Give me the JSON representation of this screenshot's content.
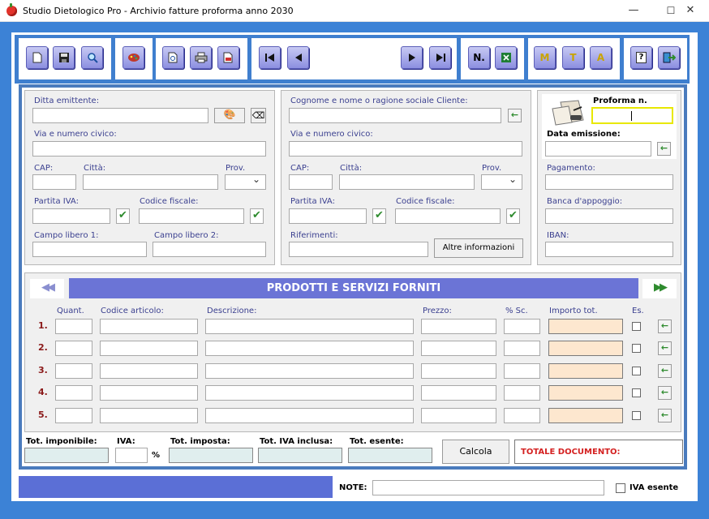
{
  "window": {
    "title": "Studio Dietologico Pro - Archivio fatture proforma anno 2030",
    "minimize": "—",
    "maximize": "☐",
    "close": "✕"
  },
  "toolbar": {
    "n_label": "N.",
    "m_label": "M",
    "t_label": "T",
    "a_label": "A",
    "help_label": "?"
  },
  "emitter": {
    "company_label": "Ditta emittente:",
    "address_label": "Via e numero civico:",
    "cap_label": "CAP:",
    "city_label": "Città:",
    "prov_label": "Prov.",
    "vat_label": "Partita IVA:",
    "tax_code_label": "Codice fiscale:",
    "free1_label": "Campo libero 1:",
    "free2_label": "Campo libero 2:"
  },
  "client": {
    "name_label": "Cognome e nome o ragione sociale Cliente:",
    "address_label": "Via e numero civico:",
    "cap_label": "CAP:",
    "city_label": "Città:",
    "prov_label": "Prov.",
    "vat_label": "Partita IVA:",
    "tax_code_label": "Codice fiscale:",
    "references_label": "Riferimenti:",
    "more_info_button": "Altre informazioni"
  },
  "proforma": {
    "number_label": "Proforma n.",
    "date_label": "Data emissione:",
    "payment_label": "Pagamento:",
    "bank_label": "Banca d'appoggio:",
    "iban_label": "IBAN:"
  },
  "products": {
    "title": "PRODOTTI E SERVIZI FORNITI",
    "col_qty": "Quant.",
    "col_code": "Codice articolo:",
    "col_desc": "Descrizione:",
    "col_price": "Prezzo:",
    "col_discount": "% Sc.",
    "col_amount": "Importo tot.",
    "col_exempt": "Es.",
    "rows": [
      "1.",
      "2.",
      "3.",
      "4.",
      "5."
    ]
  },
  "totals": {
    "taxable_label": "Tot. imponibile:",
    "vat_label": "IVA:",
    "percent": "%",
    "tax_label": "Tot. imposta:",
    "vat_included_label": "Tot. IVA inclusa:",
    "exempt_label": "Tot. esente:",
    "calc_button": "Calcola",
    "total_doc_label": "TOTALE DOCUMENTO:"
  },
  "footer": {
    "notes_label": "NOTE:",
    "vat_exempt_label": "IVA esente"
  },
  "colors": {
    "frame": "#3c82d6",
    "toolbar_button": "#8c8fe0",
    "banner": "#6b74d6",
    "total_red": "#d42121",
    "row_number": "#8b1a1a",
    "amount_field": "#fde7cf"
  }
}
